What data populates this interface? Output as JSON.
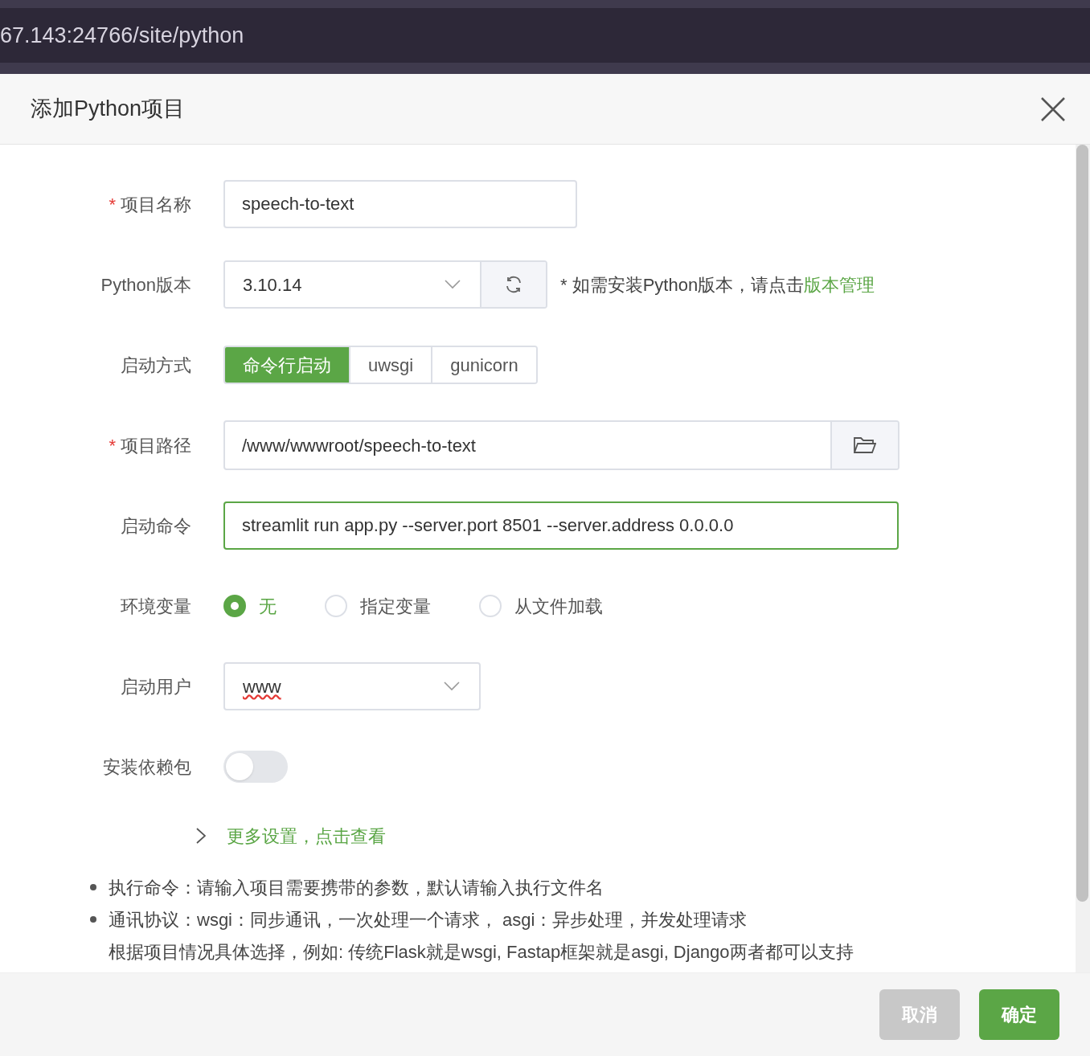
{
  "browser": {
    "url": "67.143:24766/site/python"
  },
  "dialog": {
    "title": "添加Python项目"
  },
  "rows": [
    {
      "kind": "text",
      "label": "项目名称",
      "required_mark": "*",
      "value": "speech-to-text",
      "focused": false
    },
    {
      "kind": "select_refresh",
      "label": "Python版本",
      "value": "3.10.14",
      "hint": "* 如需安装Python版本，请点击",
      "link": "版本管理"
    },
    {
      "kind": "segmented",
      "label": "启动方式",
      "options": [
        {
          "label": "命令行启动",
          "selected": true
        },
        {
          "label": "uwsgi",
          "selected": false
        },
        {
          "label": "gunicorn",
          "selected": false
        }
      ]
    },
    {
      "kind": "path",
      "label": "项目路径",
      "required_mark": "*",
      "value": "/www/wwwroot/speech-to-text"
    },
    {
      "kind": "text",
      "label": "启动命令",
      "value": "streamlit run app.py --server.port 8501 --server.address 0.0.0.0",
      "focused": true
    },
    {
      "kind": "radio",
      "label": "环境变量",
      "options": [
        {
          "label": "无",
          "selected": true
        },
        {
          "label": "指定变量",
          "selected": false
        },
        {
          "label": "从文件加载",
          "selected": false
        }
      ]
    },
    {
      "kind": "select",
      "label": "启动用户",
      "value": "www",
      "misspelled": true
    },
    {
      "kind": "switch",
      "label": "安装依赖包",
      "on": false
    }
  ],
  "more_settings": {
    "label": "更多设置，点击查看",
    "expanded": false
  },
  "notes": [
    {
      "text": "执行命令：请输入项目需要携带的参数，默认请输入执行文件名",
      "kind": "bullet"
    },
    {
      "text": "通讯协议：wsgi：同步通讯，一次处理一个请求， asgi：异步处理，并发处理请求",
      "kind": "bullet"
    },
    {
      "text": "根据项目情况具体选择，例如: 传统Flask就是wsgi, Fastap框架就是asgi, Django两者都可以支持",
      "kind": "continuation"
    }
  ],
  "buttons": [
    {
      "label": "取消",
      "kind": "cancel"
    },
    {
      "label": "确定",
      "kind": "primary"
    }
  ]
}
